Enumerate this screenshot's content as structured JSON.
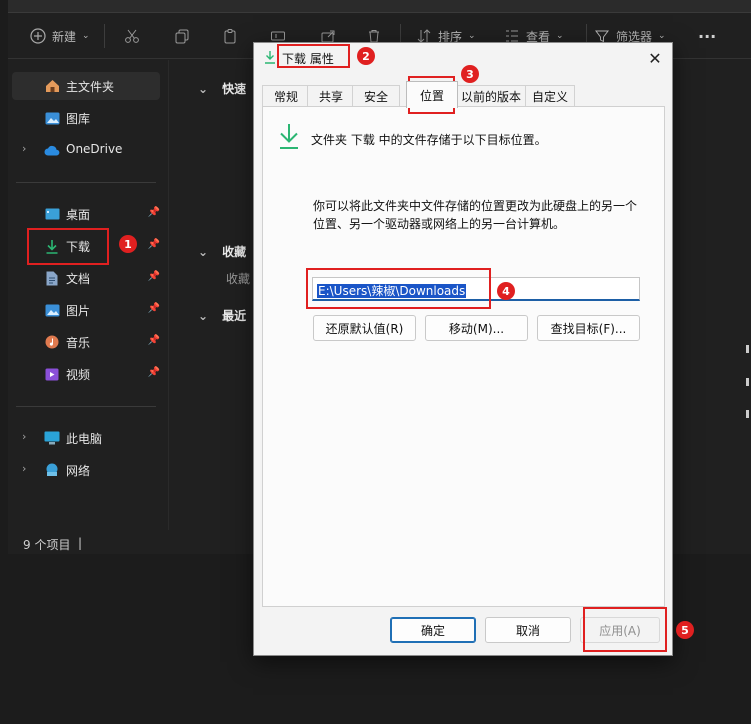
{
  "explorer": {
    "toolbar": {
      "new_label": "新建",
      "sort_label": "排序",
      "view_label": "查看",
      "filter_label": "筛选器",
      "more_label": "···"
    },
    "sidebar": {
      "home": "主文件夹",
      "gallery": "图库",
      "onedrive": "OneDrive",
      "desktop": "桌面",
      "downloads": "下载",
      "documents": "文档",
      "pictures": "图片",
      "music": "音乐",
      "videos": "视频",
      "this_pc": "此电脑",
      "network": "网络"
    },
    "sections": {
      "quick": "快速",
      "favorites": "收藏",
      "favorites_sub": "收藏",
      "recent": "最近"
    },
    "status": {
      "count": "9 个项目",
      "sep": "|"
    }
  },
  "dialog": {
    "title": "下载 属性",
    "tabs": [
      "常规",
      "共享",
      "安全",
      "位置",
      "以前的版本",
      "自定义"
    ],
    "active_tab": "位置",
    "info_text": "文件夹 下载 中的文件存储于以下目标位置。",
    "desc_line1": "你可以将此文件夹中文件存储的位置更改为此硬盘上的另一个",
    "desc_line2": "位置、另一个驱动器或网络上的另一台计算机。",
    "path_value": "E:\\Users\\辣椒\\Downloads",
    "restore_button": "还原默认值(R)",
    "move_button": "移动(M)...",
    "find_button": "查找目标(F)...",
    "ok_button": "确定",
    "cancel_button": "取消",
    "apply_button": "应用(A)"
  },
  "badges": [
    "1",
    "2",
    "3",
    "4",
    "5"
  ],
  "colors": {
    "annotation": "#e02020",
    "accent": "#1f6fb5",
    "download_icon": "#2bb673"
  }
}
